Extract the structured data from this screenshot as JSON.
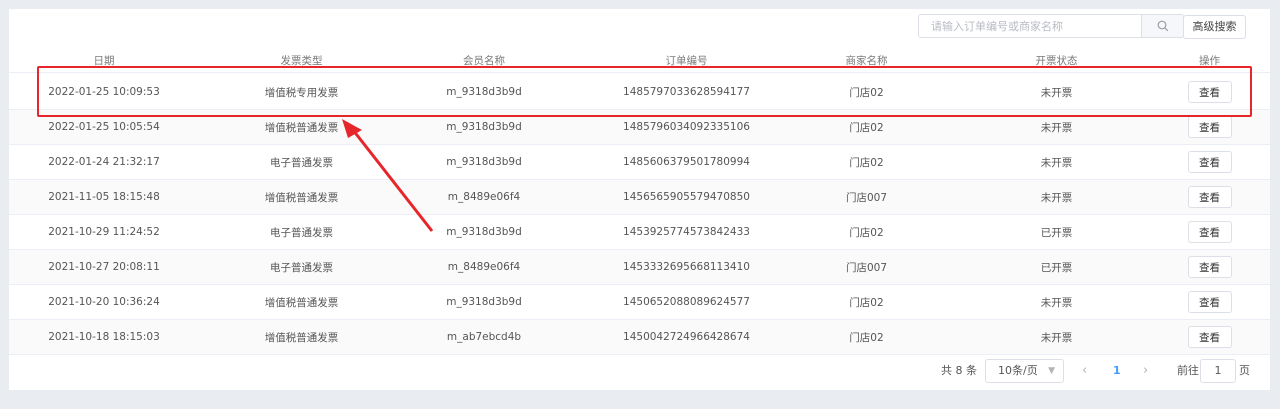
{
  "search": {
    "placeholder": "请输入订单编号或商家名称",
    "icon": "search-icon",
    "advanced_label": "高级搜索"
  },
  "table": {
    "columns": [
      "日期",
      "发票类型",
      "会员名称",
      "订单编号",
      "商家名称",
      "开票状态",
      "操作"
    ],
    "rows": [
      [
        "2022-01-25 10:09:53",
        "增值税专用发票",
        "m_9318d3b9d",
        "1485797033628594177",
        "门店02",
        "未开票",
        "查看"
      ],
      [
        "2022-01-25 10:05:54",
        "增值税普通发票",
        "m_9318d3b9d",
        "1485796034092335106",
        "门店02",
        "未开票",
        "查看"
      ],
      [
        "2022-01-24 21:32:17",
        "电子普通发票",
        "m_9318d3b9d",
        "1485606379501780994",
        "门店02",
        "未开票",
        "查看"
      ],
      [
        "2021-11-05 18:15:48",
        "增值税普通发票",
        "m_8489e06f4",
        "1456565905579470850",
        "门店007",
        "未开票",
        "查看"
      ],
      [
        "2021-10-29 11:24:52",
        "电子普通发票",
        "m_9318d3b9d",
        "1453925774573842433",
        "门店02",
        "已开票",
        "查看"
      ],
      [
        "2021-10-27 20:08:11",
        "电子普通发票",
        "m_8489e06f4",
        "1453332695668113410",
        "门店007",
        "已开票",
        "查看"
      ],
      [
        "2021-10-20 10:36:24",
        "增值税普通发票",
        "m_9318d3b9d",
        "1450652088089624577",
        "门店02",
        "未开票",
        "查看"
      ],
      [
        "2021-10-18 18:15:03",
        "增值税普通发票",
        "m_ab7ebcd4b",
        "1450042724966428674",
        "门店02",
        "未开票",
        "查看"
      ]
    ]
  },
  "pagination": {
    "total": "共 8 条",
    "page_size": "10条/页",
    "prev_icon": "chevron-left-icon",
    "current_page": "1",
    "next_icon": "chevron-right-icon",
    "goto_prefix": "前往",
    "goto_value": "1",
    "goto_suffix": "页"
  },
  "annotation": {
    "color": "#e6262b"
  },
  "colors": {
    "page_bg": "#e9edf2",
    "panel_bg": "#ffffff",
    "active_page": "#409eff"
  }
}
